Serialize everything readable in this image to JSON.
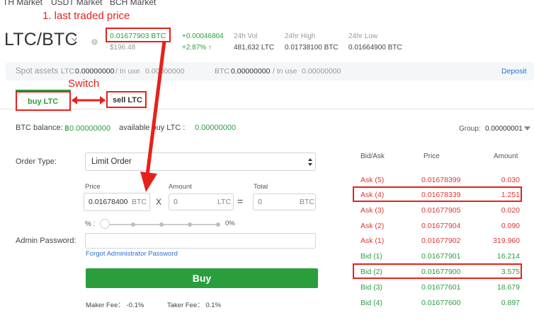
{
  "top_tabs": [
    "TH Market",
    "USDT Market",
    "BCH Market"
  ],
  "annotations": {
    "last_traded": "1. last traded price",
    "switch": "Switch"
  },
  "ticker": {
    "pair": "LTC/BTC",
    "last_price": "0.01677903 BTC",
    "last_price_usd": "$196.48",
    "change_abs": "+0.00046804",
    "change_pct": "+2.87% ↑",
    "vol_label": "24h Vol",
    "vol_value": "481,632 LTC",
    "high_label": "24hr High",
    "high_value": "0.01738100 BTC",
    "low_label": "24hr Low",
    "low_value": "0.01664900 BTC"
  },
  "assets": {
    "spot_label": "Spot assets",
    "ltc_label": "LTC",
    "ltc_value": "0.00000000",
    "ltc_inuse_label": "/ In use",
    "ltc_inuse_value": "0.00000000",
    "btc_label": "BTC",
    "btc_value": "0.00000000",
    "btc_inuse_label": "/ In use",
    "btc_inuse_value": "0.00000000",
    "deposit": "Deposit"
  },
  "tabs": {
    "buy": "buy LTC",
    "sell": "sell LTC"
  },
  "balance": {
    "btc_label": "BTC balance:",
    "btc_value": "฿0.00000000",
    "avail_label": "available buy LTC :",
    "avail_value": "0.00000000",
    "group_label": "Group:",
    "group_value": "0.00000001"
  },
  "form": {
    "order_type_label": "Order Type:",
    "order_type_value": "Limit Order",
    "price_label": "Price",
    "price_value": "0.01678400",
    "price_unit": "BTC",
    "times": "X",
    "amount_label": "Amount",
    "amount_placeholder": "0",
    "amount_unit": "LTC",
    "equals": "=",
    "total_label": "Total",
    "total_placeholder": "0",
    "total_unit": "BTC",
    "pct_label": "% :",
    "pct_value": "0%",
    "admin_label": "Admin Password:",
    "forgot": "Forgot Administrator Password",
    "buy_button": "Buy",
    "maker_fee": "Maker Fee： -0.1%",
    "taker_fee": "Taker Fee： 0.1%"
  },
  "orderbook": {
    "headers": [
      "Bid/Ask",
      "Price",
      "Amount"
    ],
    "rows": [
      {
        "side": "Ask (5)",
        "price": "0.01678399",
        "amount": "0.030"
      },
      {
        "side": "Ask (4)",
        "price": "0.01678339",
        "amount": "1.251"
      },
      {
        "side": "Ask (3)",
        "price": "0.01677905",
        "amount": "0.020"
      },
      {
        "side": "Ask (2)",
        "price": "0.01677904",
        "amount": "0.090"
      },
      {
        "side": "Ask (1)",
        "price": "0.01677902",
        "amount": "319.960"
      },
      {
        "side": "Bid (1)",
        "price": "0.01677901",
        "amount": "16.214"
      },
      {
        "side": "Bid (2)",
        "price": "0.01677900",
        "amount": "3.575"
      },
      {
        "side": "Bid (3)",
        "price": "0.01677601",
        "amount": "18.679"
      },
      {
        "side": "Bid (4)",
        "price": "0.01677600",
        "amount": "0.897"
      }
    ]
  },
  "colors": {
    "green": "#2a9e3d",
    "red": "#d93a32",
    "annotation": "#e8201c"
  }
}
